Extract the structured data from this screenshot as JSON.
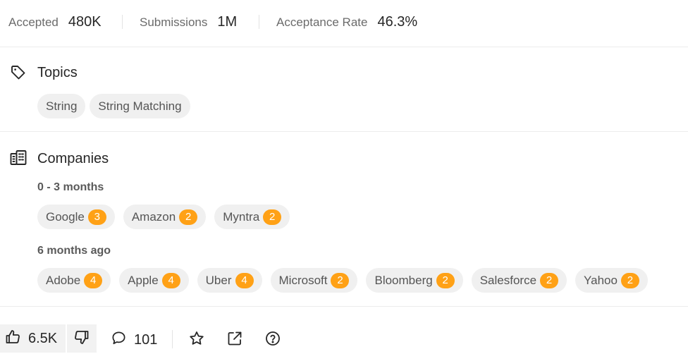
{
  "stats": [
    {
      "label": "Accepted",
      "value": "480K"
    },
    {
      "label": "Submissions",
      "value": "1M"
    },
    {
      "label": "Acceptance Rate",
      "value": "46.3%"
    }
  ],
  "topics": {
    "title": "Topics",
    "icon": "tag-icon",
    "tags": [
      "String",
      "String Matching"
    ]
  },
  "companies": {
    "title": "Companies",
    "icon": "building-icon",
    "badge_color": "#ffa116",
    "groups": [
      {
        "label": "0 - 3 months",
        "items": [
          {
            "name": "Google",
            "count": "3"
          },
          {
            "name": "Amazon",
            "count": "2"
          },
          {
            "name": "Myntra",
            "count": "2"
          }
        ]
      },
      {
        "label": "6 months ago",
        "items": [
          {
            "name": "Adobe",
            "count": "4"
          },
          {
            "name": "Apple",
            "count": "4"
          },
          {
            "name": "Uber",
            "count": "4"
          },
          {
            "name": "Microsoft",
            "count": "2"
          },
          {
            "name": "Bloomberg",
            "count": "2"
          },
          {
            "name": "Salesforce",
            "count": "2"
          },
          {
            "name": "Yahoo",
            "count": "2"
          }
        ]
      }
    ]
  },
  "footer": {
    "likes": "6.5K",
    "comments": "101",
    "icons": [
      "thumbs-up-icon",
      "thumbs-down-icon",
      "comment-icon",
      "star-icon",
      "share-icon",
      "help-icon"
    ]
  }
}
